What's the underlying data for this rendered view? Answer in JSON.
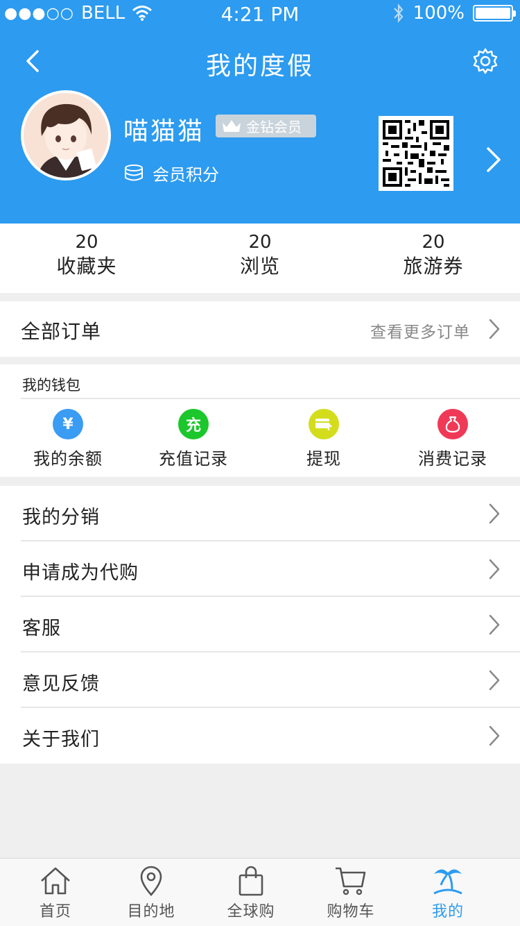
{
  "status_bar": {
    "carrier": "BELL",
    "signal_dots": "●●●○○",
    "time": "4:21 PM",
    "battery": "100%"
  },
  "nav": {
    "title": "我的度假"
  },
  "profile": {
    "username": "喵猫猫",
    "member_badge": "金钻会员",
    "points_label": "会员积分"
  },
  "stats": [
    {
      "count": "20",
      "label": "收藏夹"
    },
    {
      "count": "20",
      "label": "浏览"
    },
    {
      "count": "20",
      "label": "旅游券"
    }
  ],
  "orders": {
    "title": "全部订单",
    "more_label": "查看更多订单"
  },
  "wallet": {
    "title": "我的钱包",
    "items": [
      {
        "label": "我的余额",
        "icon": "yen-icon",
        "color": "#3a9cf3",
        "glyph": "¥"
      },
      {
        "label": "充值记录",
        "icon": "recharge-icon",
        "color": "#1bc72b",
        "glyph": "充"
      },
      {
        "label": "提现",
        "icon": "withdraw-icon",
        "color": "#d4dd1c",
        "glyph": ""
      },
      {
        "label": "消费记录",
        "icon": "money-bag-icon",
        "color": "#f03957",
        "glyph": ""
      }
    ]
  },
  "menu": [
    {
      "label": "我的分销"
    },
    {
      "label": "申请成为代购"
    },
    {
      "label": "客服"
    },
    {
      "label": "意见反馈"
    },
    {
      "label": "关于我们"
    }
  ],
  "tabbar": [
    {
      "label": "首页",
      "icon": "home-icon",
      "active": false
    },
    {
      "label": "目的地",
      "icon": "location-pin-icon",
      "active": false
    },
    {
      "label": "全球购",
      "icon": "shopping-bag-icon",
      "active": false
    },
    {
      "label": "购物车",
      "icon": "cart-icon",
      "active": false
    },
    {
      "label": "我的",
      "icon": "palm-tree-icon",
      "active": true
    }
  ],
  "colors": {
    "header_bg": "#2c9bf0",
    "active_tab": "#2c9bf0",
    "page_bg": "#efeff0"
  }
}
